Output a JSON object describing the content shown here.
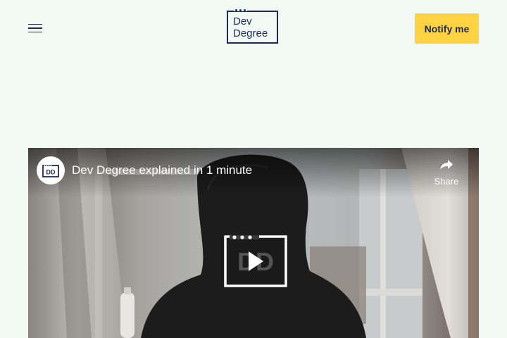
{
  "header": {
    "menu_icon": "hamburger-menu-icon",
    "logo": {
      "line1": "Dev",
      "line2": "Degree",
      "color": "#1c2a5a"
    },
    "notify_label": "Notify me",
    "notify_color": "#fdd341"
  },
  "video": {
    "channel_avatar_text": "DD",
    "title": "Dev Degree explained in 1 minute",
    "share_label": "Share",
    "share_icon": "share-arrow-icon",
    "play_icon": "play-icon",
    "play_logo_text": "DD"
  },
  "colors": {
    "background": "#f2f8f3",
    "navy": "#1c2a5a"
  }
}
